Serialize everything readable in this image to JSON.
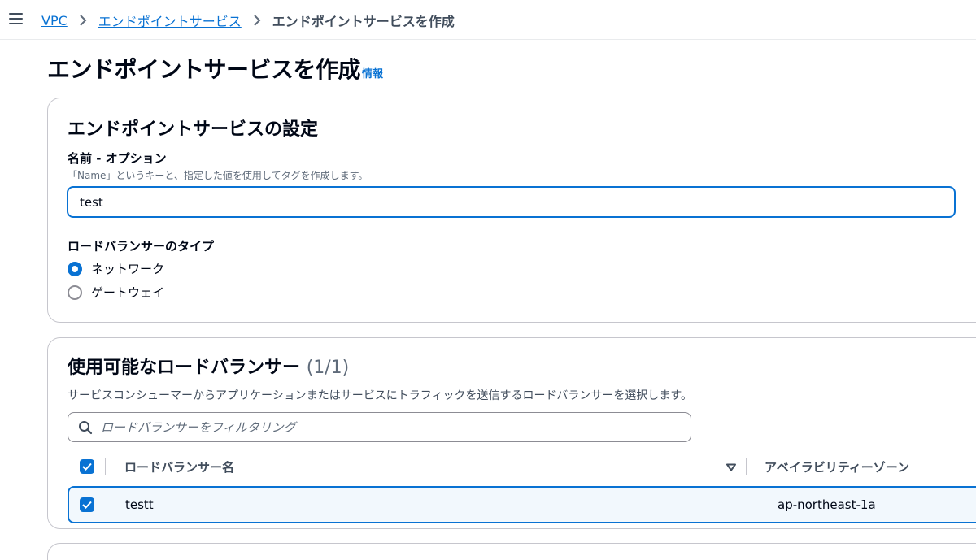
{
  "topbar": {
    "breadcrumbs": [
      {
        "label": "VPC"
      },
      {
        "label": "エンドポイントサービス"
      },
      {
        "label": "エンドポイントサービスを作成"
      }
    ]
  },
  "page": {
    "title": "エンドポイントサービスを作成",
    "info_link": "情報"
  },
  "settings": {
    "heading": "エンドポイントサービスの設定",
    "name_label": "名前 - オプション",
    "name_desc": "「Name」というキーと、指定した値を使用してタグを作成します。",
    "name_value": "test",
    "lb_type_label": "ロードバランサーのタイプ",
    "lb_type_options": [
      {
        "label": "ネットワーク",
        "selected": true
      },
      {
        "label": "ゲートウェイ",
        "selected": false
      }
    ]
  },
  "load_balancers": {
    "heading": "使用可能なロードバランサー",
    "count": "(1/1)",
    "description": "サービスコンシューマーからアプリケーションまたはサービスにトラフィックを送信するロードバランサーを選択します。",
    "search_placeholder": "ロードバランサーをフィルタリング",
    "columns": [
      "ロードバランサー名",
      "アベイラビリティーゾーン"
    ],
    "rows": [
      {
        "name": "testt",
        "az": "ap-northeast-1a",
        "selected": true
      }
    ]
  },
  "colors": {
    "accent": "#0972d3",
    "row_selected_bg": "#f2f8fd",
    "border": "#c6c6cd"
  }
}
